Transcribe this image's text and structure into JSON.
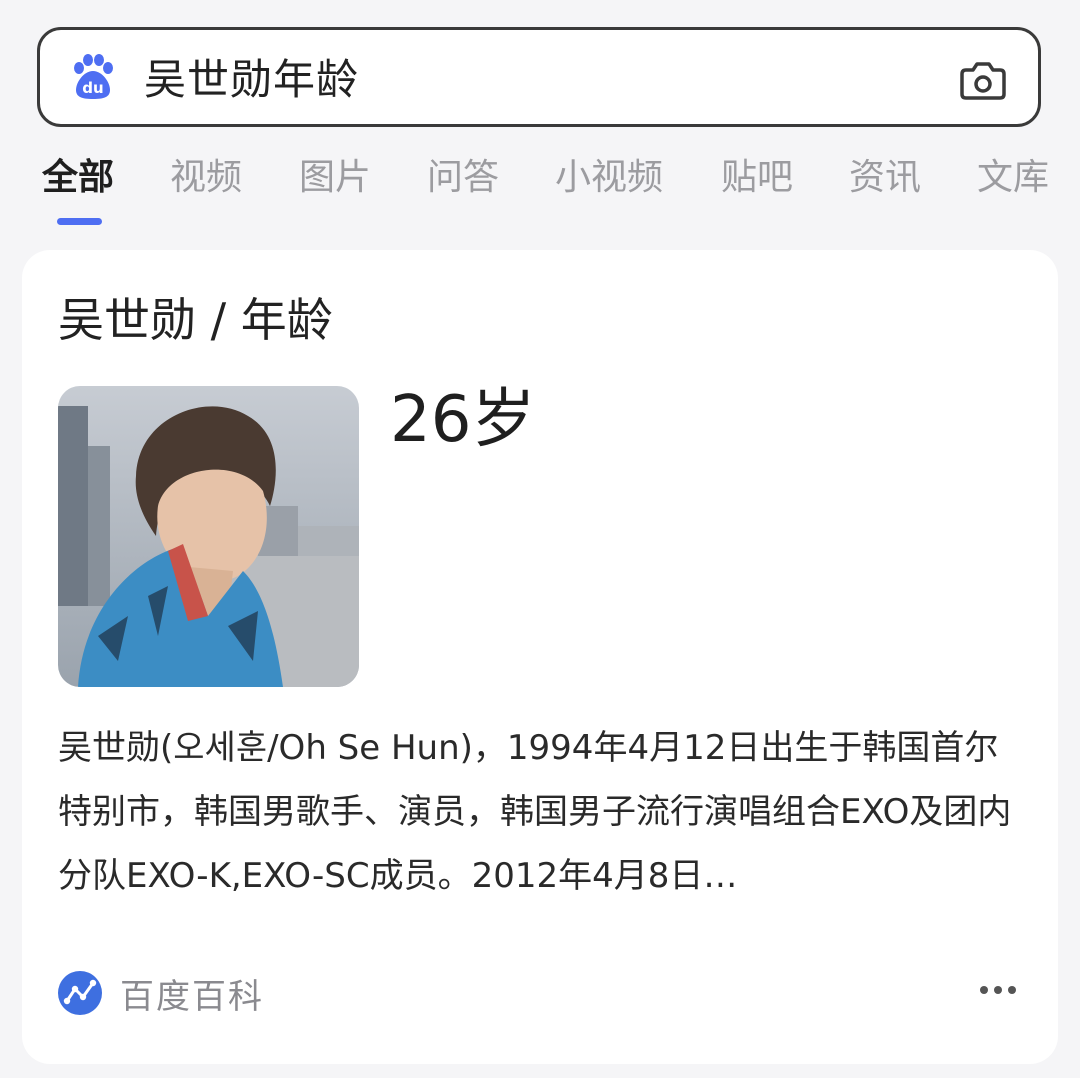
{
  "search": {
    "query": "吴世勋年龄",
    "logo_text": "du"
  },
  "tabs": [
    {
      "label": "全部",
      "active": true
    },
    {
      "label": "视频",
      "active": false
    },
    {
      "label": "图片",
      "active": false
    },
    {
      "label": "问答",
      "active": false
    },
    {
      "label": "小视频",
      "active": false
    },
    {
      "label": "贴吧",
      "active": false
    },
    {
      "label": "资讯",
      "active": false
    },
    {
      "label": "文库",
      "active": false
    }
  ],
  "card": {
    "title": "吴世勋 / 年龄",
    "age": "26岁",
    "description": "吴世勋(오세훈/Oh Se Hun)，1994年4月12日出生于韩国首尔特别市，韩国男歌手、演员，韩国男子流行演唱组合EXO及团内分队EXO-K,EXO-SC成员。2012年4月8日…",
    "source": "百度百科"
  },
  "colors": {
    "accent": "#4e6ef2",
    "tab_inactive": "#9c9ca0",
    "background": "#f5f5f7"
  },
  "icons": {
    "logo": "baidu-paw-logo",
    "camera": "camera-icon",
    "source": "baike-icon",
    "more": "more-dots-icon"
  }
}
